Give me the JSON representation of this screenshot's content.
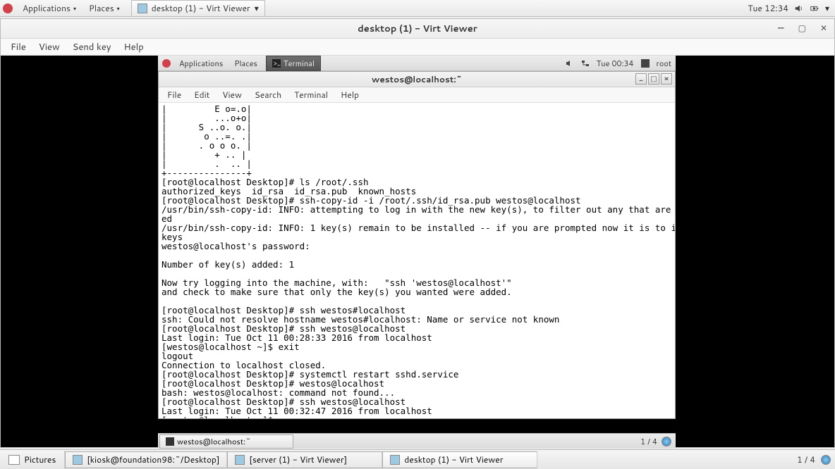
{
  "outer_panel": {
    "apps": "Applications",
    "places": "Places",
    "active_task": "desktop (1) - Virt Viewer",
    "clock": "Tue 12:34"
  },
  "virt": {
    "title": "desktop (1) - Virt Viewer",
    "menu": {
      "file": "File",
      "view": "View",
      "sendkey": "Send key",
      "help": "Help"
    }
  },
  "inner_panel": {
    "apps": "Applications",
    "places": "Places",
    "task": "Terminal",
    "clock": "Tue 00:34",
    "user": "root"
  },
  "terminal": {
    "title": "westos@localhost:~",
    "menu": {
      "file": "File",
      "edit": "Edit",
      "view": "View",
      "search": "Search",
      "terminal": "Terminal",
      "help": "Help"
    },
    "content": "|         E o=.o|\n|         ...o+o|\n|      S ..o. o.|\n|       o ..=. .|\n|      . o o o. |\n|         + .. |\n|         .  .. |\n+---------------+\n[root@localhost Desktop]# ls /root/.ssh\nauthorized_keys  id_rsa  id_rsa.pub  known_hosts\n[root@localhost Desktop]# ssh-copy-id -i /root/.ssh/id_rsa.pub westos@localhost\n/usr/bin/ssh-copy-id: INFO: attempting to log in with the new key(s), to filter out any that are already install\ned\n/usr/bin/ssh-copy-id: INFO: 1 key(s) remain to be installed -- if you are prompted now it is to install the new \nkeys\nwestos@localhost's password: \n\nNumber of key(s) added: 1\n\nNow try logging into the machine, with:   \"ssh 'westos@localhost'\"\nand check to make sure that only the key(s) you wanted were added.\n\n[root@localhost Desktop]# ssh westos#localhost\nssh: Could not resolve hostname westos#localhost: Name or service not known\n[root@localhost Desktop]# ssh westos@localhost\nLast login: Tue Oct 11 00:28:33 2016 from localhost\n[westos@localhost ~]$ exit\nlogout\nConnection to localhost closed.\n[root@localhost Desktop]# systemctl restart sshd.service\n[root@localhost Desktop]# westos@localhost\nbash: westos@localhost: command not found...\n[root@localhost Desktop]# ssh westos@localhost\nLast login: Tue Oct 11 00:32:47 2016 from localhost\n[westos@localhost ~]$ "
  },
  "inner_bottom": {
    "task": "westos@localhost:~",
    "workspace": "1 / 4"
  },
  "outer_bottom": {
    "pictures": "Pictures",
    "tasks": [
      "[kiosk@foundation98:~/Desktop]",
      "[server (1) - Virt Viewer]",
      "desktop (1) - Virt Viewer"
    ],
    "workspace": "1 / 4"
  }
}
